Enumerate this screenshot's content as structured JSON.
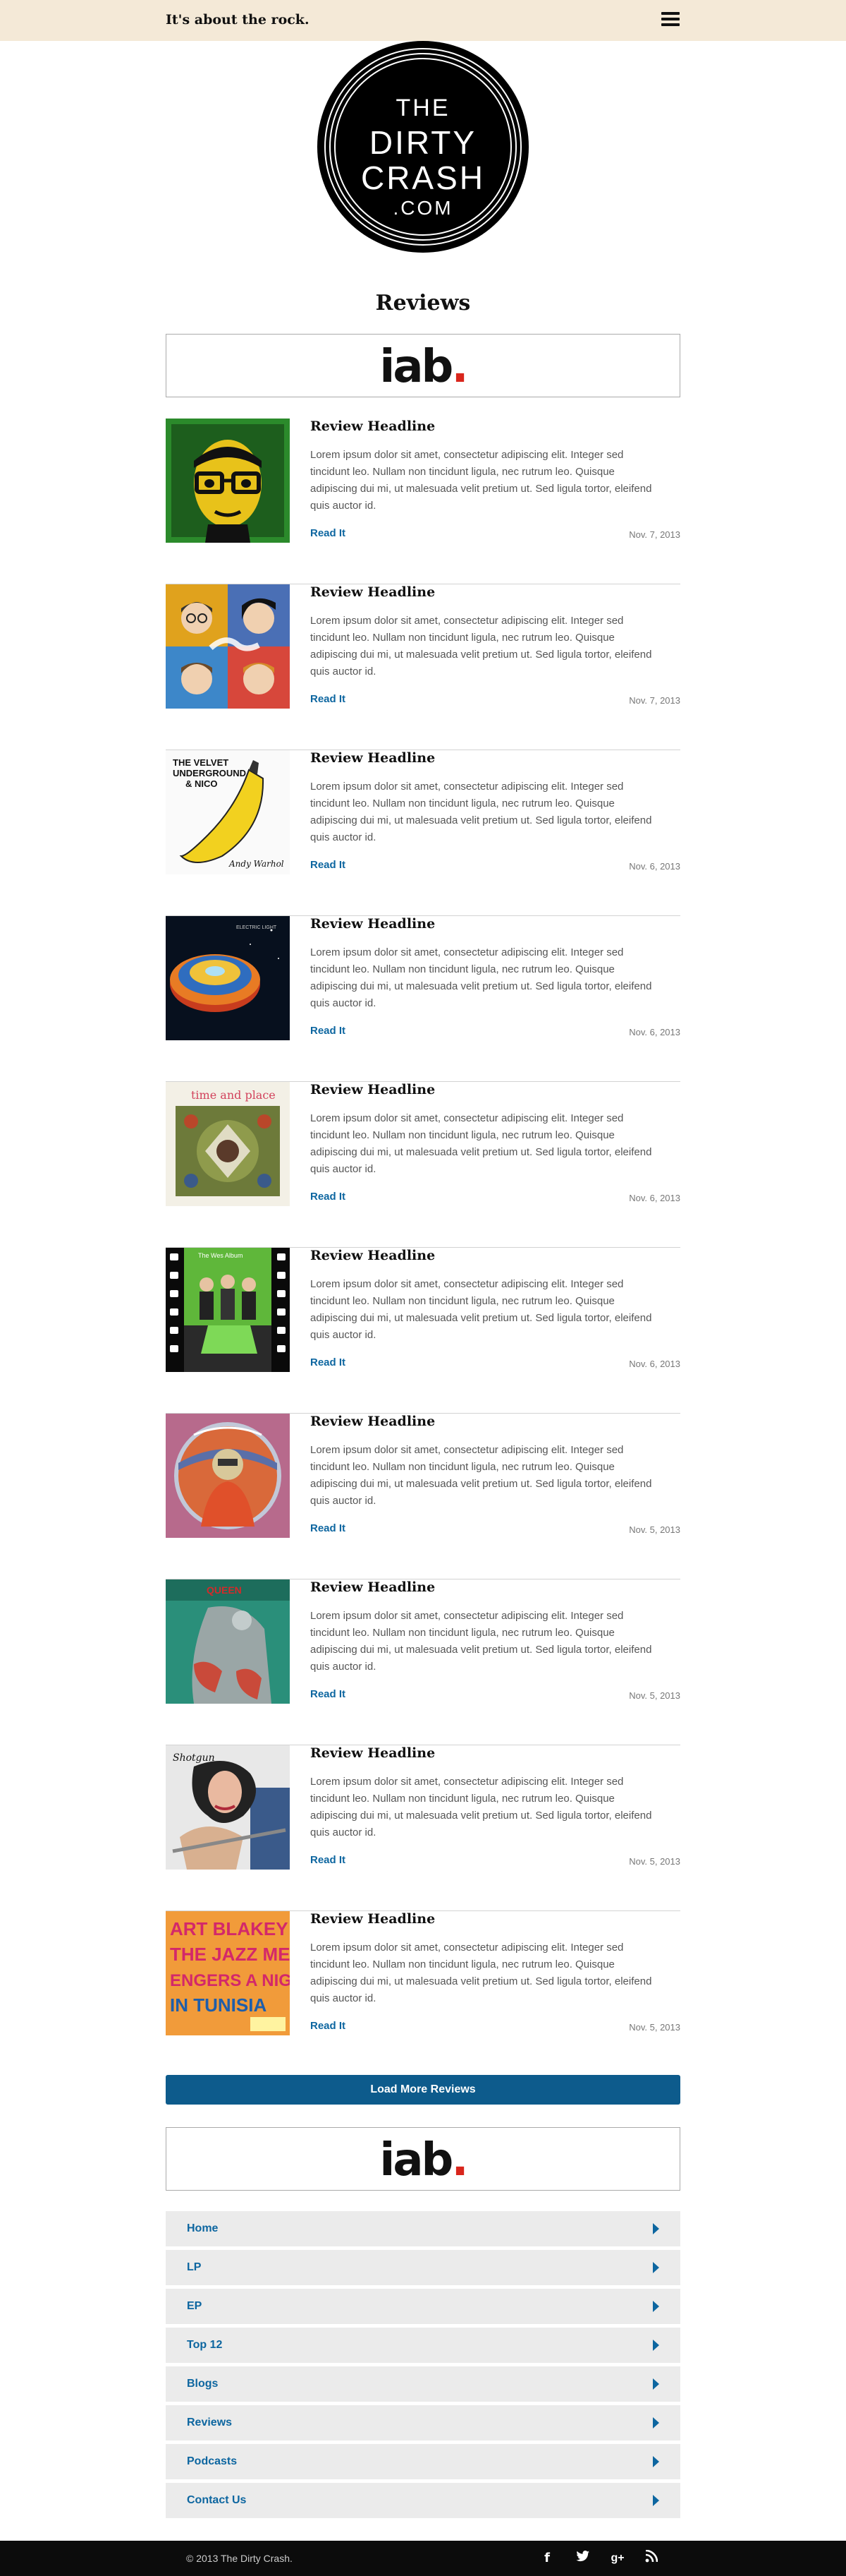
{
  "header": {
    "tagline": "It's about the rock."
  },
  "logo": {
    "line1": "THE",
    "line2": "DIRTY",
    "line3": "CRASH",
    "line4": ".COM"
  },
  "page": {
    "title": "Reviews"
  },
  "ad": {
    "text": "iab",
    "dot": "."
  },
  "reviews": [
    {
      "headline": "Review Headline",
      "excerpt": "Lorem ipsum dolor sit amet, consectetur adipiscing elit. Integer sed tincidunt leo. Nullam non tincidunt ligula, nec rutrum leo. Quisque adipiscing dui mi, ut malesuada velit pretium ut. Sed ligula tortor, eleifend quis auctor id.",
      "read": "Read It",
      "date": "Nov. 7, 2013"
    },
    {
      "headline": "Review Headline",
      "excerpt": "Lorem ipsum dolor sit amet, consectetur adipiscing elit. Integer sed tincidunt leo. Nullam non tincidunt ligula, nec rutrum leo. Quisque adipiscing dui mi, ut malesuada velit pretium ut. Sed ligula tortor, eleifend quis auctor id.",
      "read": "Read It",
      "date": "Nov. 7, 2013"
    },
    {
      "headline": "Review Headline",
      "excerpt": "Lorem ipsum dolor sit amet, consectetur adipiscing elit. Integer sed tincidunt leo. Nullam non tincidunt ligula, nec rutrum leo. Quisque adipiscing dui mi, ut malesuada velit pretium ut. Sed ligula tortor, eleifend quis auctor id.",
      "read": "Read It",
      "date": "Nov. 6, 2013"
    },
    {
      "headline": "Review Headline",
      "excerpt": "Lorem ipsum dolor sit amet, consectetur adipiscing elit. Integer sed tincidunt leo. Nullam non tincidunt ligula, nec rutrum leo. Quisque adipiscing dui mi, ut malesuada velit pretium ut. Sed ligula tortor, eleifend quis auctor id.",
      "read": "Read It",
      "date": "Nov. 6, 2013"
    },
    {
      "headline": "Review Headline",
      "excerpt": "Lorem ipsum dolor sit amet, consectetur adipiscing elit. Integer sed tincidunt leo. Nullam non tincidunt ligula, nec rutrum leo. Quisque adipiscing dui mi, ut malesuada velit pretium ut. Sed ligula tortor, eleifend quis auctor id.",
      "read": "Read It",
      "date": "Nov. 6, 2013"
    },
    {
      "headline": "Review Headline",
      "excerpt": "Lorem ipsum dolor sit amet, consectetur adipiscing elit. Integer sed tincidunt leo. Nullam non tincidunt ligula, nec rutrum leo. Quisque adipiscing dui mi, ut malesuada velit pretium ut. Sed ligula tortor, eleifend quis auctor id.",
      "read": "Read It",
      "date": "Nov. 6, 2013"
    },
    {
      "headline": "Review Headline",
      "excerpt": "Lorem ipsum dolor sit amet, consectetur adipiscing elit. Integer sed tincidunt leo. Nullam non tincidunt ligula, nec rutrum leo. Quisque adipiscing dui mi, ut malesuada velit pretium ut. Sed ligula tortor, eleifend quis auctor id.",
      "read": "Read It",
      "date": "Nov. 5, 2013"
    },
    {
      "headline": "Review Headline",
      "excerpt": "Lorem ipsum dolor sit amet, consectetur adipiscing elit. Integer sed tincidunt leo. Nullam non tincidunt ligula, nec rutrum leo. Quisque adipiscing dui mi, ut malesuada velit pretium ut. Sed ligula tortor, eleifend quis auctor id.",
      "read": "Read It",
      "date": "Nov. 5, 2013"
    },
    {
      "headline": "Review Headline",
      "excerpt": "Lorem ipsum dolor sit amet, consectetur adipiscing elit. Integer sed tincidunt leo. Nullam non tincidunt ligula, nec rutrum leo. Quisque adipiscing dui mi, ut malesuada velit pretium ut. Sed ligula tortor, eleifend quis auctor id.",
      "read": "Read It",
      "date": "Nov. 5, 2013"
    },
    {
      "headline": "Review Headline",
      "excerpt": "Lorem ipsum dolor sit amet, consectetur adipiscing elit. Integer sed tincidunt leo. Nullam non tincidunt ligula, nec rutrum leo. Quisque adipiscing dui mi, ut malesuada velit pretium ut. Sed ligula tortor, eleifend quis auctor id.",
      "read": "Read It",
      "date": "Nov. 5, 2013"
    }
  ],
  "album_art": {
    "art3": {
      "line1": "THE VELVET",
      "line2": "UNDERGROUND",
      "line3": "& NICO",
      "sig": "Andy Warhol"
    },
    "art5": {
      "title": "time and place"
    },
    "art6": {
      "title": "The Wes Album"
    },
    "art10": {
      "line1": "ART BLAKEY &",
      "line2": "THE JAZZ MESS",
      "line3": "ENGERS A NIGHT",
      "line4": "IN TUNISIA"
    }
  },
  "load_more": {
    "label": "Load More Reviews"
  },
  "nav": {
    "items": [
      {
        "label": "Home"
      },
      {
        "label": "LP"
      },
      {
        "label": "EP"
      },
      {
        "label": "Top 12"
      },
      {
        "label": "Blogs"
      },
      {
        "label": "Reviews"
      },
      {
        "label": "Podcasts"
      },
      {
        "label": "Contact Us"
      }
    ]
  },
  "footer": {
    "copyright": "© 2013 The Dirty Crash.",
    "social": {
      "facebook": "f",
      "twitter": "t",
      "googleplus": "g+",
      "rss": "rss"
    }
  },
  "colors": {
    "topbar": "#f4e9d7",
    "link": "#0d66a0",
    "button": "#0d5b8c",
    "footer": "#0c0c0c",
    "ad_dot": "#d9261c"
  }
}
